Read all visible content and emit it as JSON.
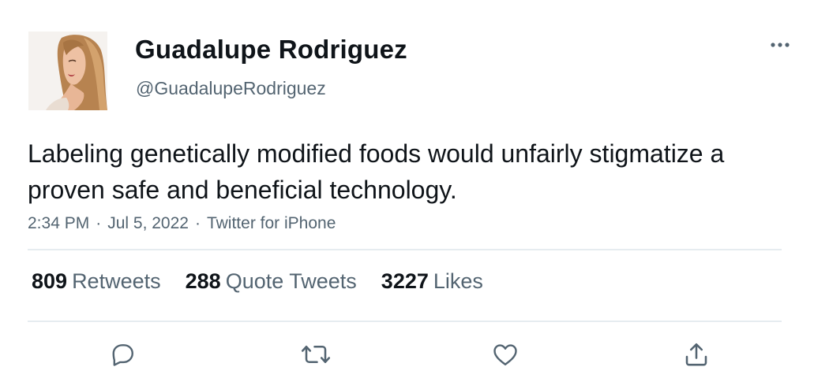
{
  "author": {
    "name": "Guadalupe Rodriguez",
    "handle": "@GuadalupeRodriguez"
  },
  "tweet": {
    "text": "Labeling genetically modified foods would unfairly stigmatize a proven safe and beneficial technology."
  },
  "meta": {
    "time": "2:34 PM",
    "separator": "·",
    "date": "Jul 5, 2022",
    "source": "Twitter for iPhone"
  },
  "stats": {
    "retweets_count": "809",
    "retweets_label": "Retweets",
    "quotes_count": "288",
    "quotes_label": "Quote Tweets",
    "likes_count": "3227",
    "likes_label": "Likes"
  },
  "icons": {
    "more": "more-icon",
    "reply": "reply-icon",
    "retweet": "retweet-icon",
    "like": "like-icon",
    "share": "share-icon"
  },
  "colors": {
    "text_primary": "#0f1419",
    "text_secondary": "#536471",
    "divider": "#e6ecf0",
    "icon": "#536471"
  }
}
